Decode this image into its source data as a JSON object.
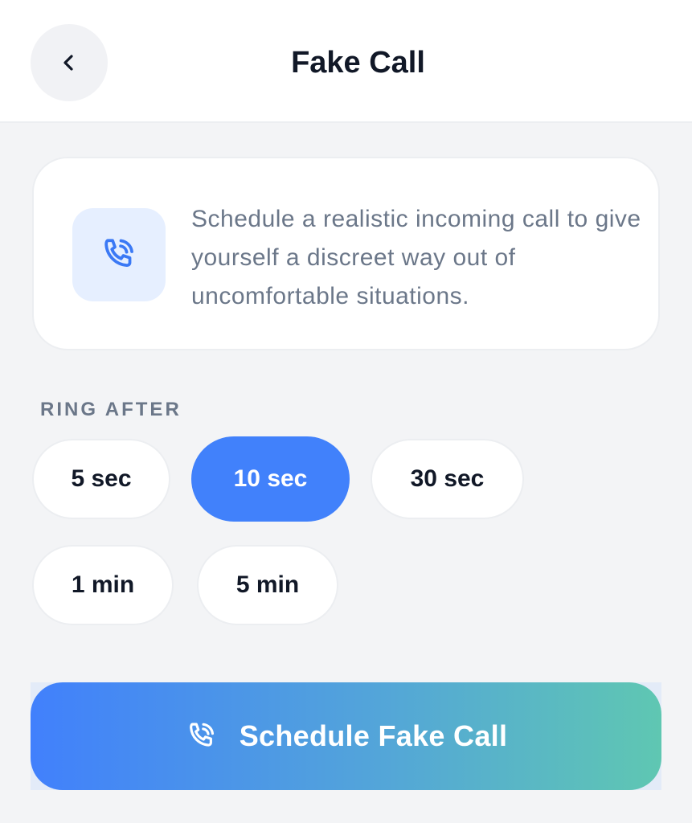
{
  "header": {
    "title": "Fake Call",
    "back_icon": "chevron-left-icon"
  },
  "info": {
    "icon": "phone-ringing-icon",
    "text": "Schedule a realistic incoming call to give yourself a discreet way out of uncomfortable situations."
  },
  "ring_after": {
    "label": "RING AFTER",
    "options": [
      {
        "label": "5 sec",
        "selected": false
      },
      {
        "label": "10 sec",
        "selected": true
      },
      {
        "label": "30 sec",
        "selected": false
      },
      {
        "label": "1 min",
        "selected": false
      },
      {
        "label": "5 min",
        "selected": false
      }
    ]
  },
  "cta": {
    "label": "Schedule Fake Call",
    "icon": "phone-ringing-icon"
  },
  "colors": {
    "accent": "#4181fb",
    "gradient_start": "#4180fc",
    "gradient_end": "#5fc7b2",
    "icon_bg": "#e6efff",
    "text_muted": "#6b7789",
    "text_dark": "#111827"
  }
}
